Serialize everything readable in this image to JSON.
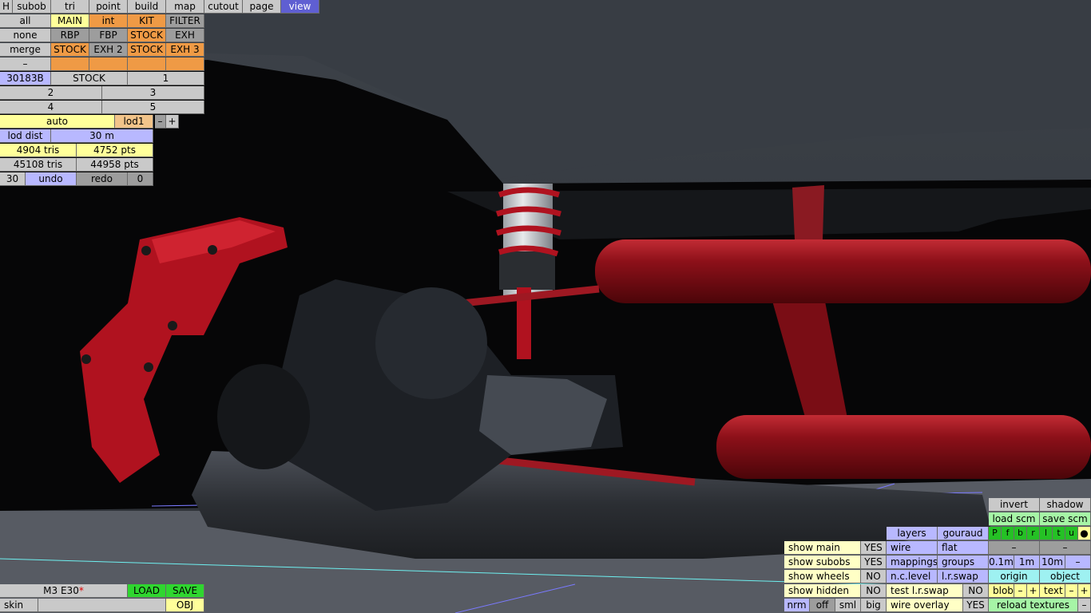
{
  "toolbar": {
    "h": "H",
    "tabs": [
      "subob",
      "tri",
      "point",
      "build",
      "map",
      "cutout",
      "page",
      "view"
    ],
    "active_tab": "view"
  },
  "panel": {
    "row1": [
      "all",
      "MAIN",
      "int",
      "KIT",
      "FILTER"
    ],
    "row2": [
      "none",
      "RBP",
      "FBP",
      "STOCK",
      "EXH"
    ],
    "row3": [
      "merge",
      "STOCK",
      "EXH 2",
      "STOCK",
      "EXH 3"
    ],
    "row4": [
      "–",
      "",
      "",
      "",
      ""
    ],
    "subob_id": "30183B",
    "subob_name": "STOCK",
    "subob_num": "1",
    "nums": [
      "2",
      "3",
      "4",
      "5"
    ],
    "lod_mode": "auto",
    "lod_name": "lod1",
    "lod_minus": "–",
    "lod_plus": "+",
    "lod_dist_label": "lod dist",
    "lod_dist_value": "30 m",
    "tris_a": "4904 tris",
    "pts_a": "4752 pts",
    "tris_b": "45108 tris",
    "pts_b": "44958 pts",
    "undo_count": "30",
    "undo": "undo",
    "redo": "redo",
    "redo_count": "0"
  },
  "file": {
    "car_name": "M3 E30",
    "modified_mark": "*",
    "load": "LOAD",
    "save": "SAVE",
    "skin": "skin",
    "skin_value": "",
    "obj": "OBJ"
  },
  "view_panel": {
    "invert": "invert",
    "shadow": "shadow",
    "load_scm": "load scm",
    "save_scm": "save scm",
    "layers": "layers",
    "gouraud": "gouraud",
    "flags": [
      "P",
      "f",
      "b",
      "r",
      "l",
      "t",
      "u",
      "●"
    ],
    "wire": "wire",
    "flat": "flat",
    "dash1": "–",
    "dash2": "–",
    "mappings": "mappings",
    "groups": "groups",
    "grid": [
      "0.1m",
      "1m",
      "10m",
      "–"
    ],
    "nclevel": "n.c.level",
    "lrswap": "l.r.swap",
    "origin": "origin",
    "object": "object",
    "test_lrswap": "test l.r.swap",
    "test_lrswap_value": "NO",
    "blob": "blob",
    "blob_minus": "–",
    "blob_plus": "+",
    "text": "text",
    "text_minus": "–",
    "text_plus": "+",
    "wire_overlay": "wire overlay",
    "wire_overlay_value": "YES",
    "reload_textures": "reload textures",
    "reload_minus": "–",
    "size_buttons": [
      "nrm",
      "off",
      "sml",
      "big"
    ],
    "show": [
      {
        "label": "show main",
        "value": "YES"
      },
      {
        "label": "show subobs",
        "value": "YES"
      },
      {
        "label": "show wheels",
        "value": "NO"
      },
      {
        "label": "show hidden",
        "value": "NO"
      }
    ]
  },
  "colors": {
    "orange": "#ef9a45",
    "blue": "#b8b8ff",
    "selected": "#5f5fd2",
    "yellow": "#ffff9a",
    "green": "#2fd62f",
    "red_part": "#b0121f"
  }
}
